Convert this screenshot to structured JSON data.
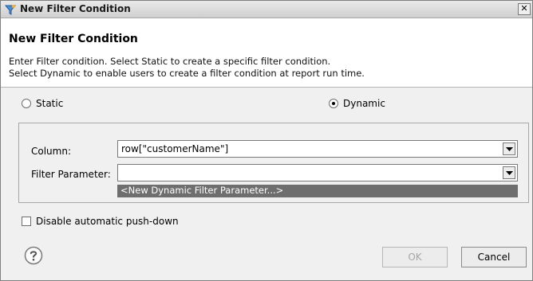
{
  "window": {
    "title": "New Filter Condition",
    "close_glyph": "✕"
  },
  "header": {
    "title": "New Filter Condition",
    "desc_line1": "Enter Filter condition. Select Static to create a specific filter condition.",
    "desc_line2": "Select Dynamic to enable users to create a filter condition at report run time."
  },
  "mode": {
    "static_label": "Static",
    "dynamic_label": "Dynamic",
    "selected": "Dynamic"
  },
  "fields": {
    "column_label": "Column:",
    "column_value": "row[\"customerName\"]",
    "filter_param_label": "Filter Parameter:",
    "filter_param_value": "",
    "filter_param_option": "<New Dynamic Filter Parameter...>"
  },
  "pushdown": {
    "label": "Disable automatic push-down",
    "checked": false
  },
  "footer": {
    "ok_label": "OK",
    "cancel_label": "Cancel"
  },
  "icons": {
    "window": "filter-dialog-icon",
    "help": "help-icon"
  }
}
